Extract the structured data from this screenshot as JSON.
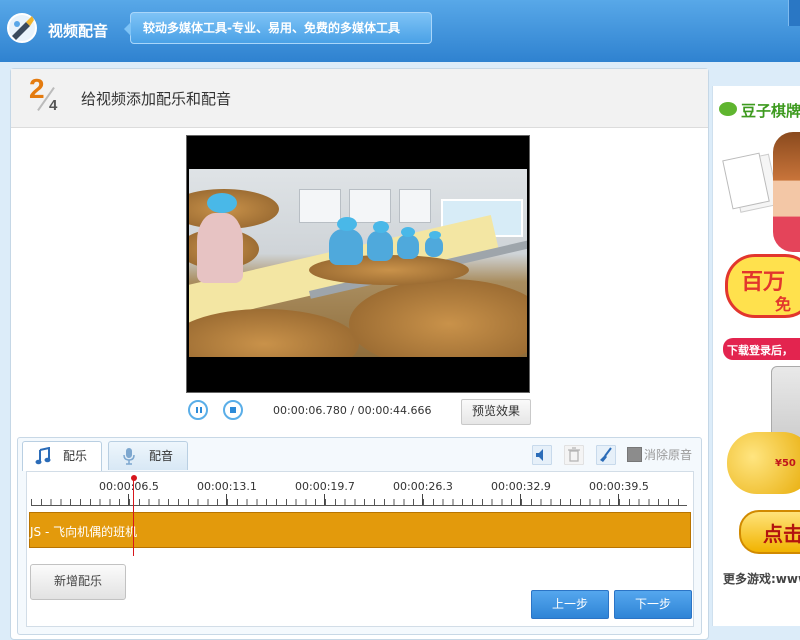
{
  "app": {
    "title": "视频配音",
    "slogan": "较动多媒体工具-专业、易用、免费的多媒体工具"
  },
  "step": {
    "current": "2",
    "total": "4",
    "title": "给视频添加配乐和配音"
  },
  "player": {
    "current_time": "00:00:06.780",
    "separator": "/",
    "total_time": "00:00:44.666",
    "preview_label": "预览效果",
    "pause_icon": "pause-icon",
    "stop_icon": "stop-icon"
  },
  "tabs": [
    {
      "label": "配乐",
      "icon": "music-note-icon",
      "active": true
    },
    {
      "label": "配音",
      "icon": "microphone-icon",
      "active": false
    }
  ],
  "tools": {
    "volume_icon": "speaker-icon",
    "delete_icon": "trash-icon",
    "clear_icon": "broom-icon",
    "mute_original_label": "消除原音",
    "mute_original_checked": false
  },
  "timeline": {
    "ticks": [
      "00:00:06.5",
      "00:00:13.1",
      "00:00:19.7",
      "00:00:26.3",
      "00:00:32.9",
      "00:00:39.5"
    ],
    "clip_label": "JS - 飞向机偶的班机",
    "clip_color": "#e39a0c",
    "playhead_color": "#d7161c"
  },
  "buttons": {
    "add_music": "新增配乐",
    "prev": "上一步",
    "next": "下一步"
  },
  "ad": {
    "brand": "豆子棋牌",
    "headline": "百万",
    "headline_sub": "免",
    "banner": "下载登录后，",
    "coins_text": "¥50",
    "cta": "点击",
    "more": "更多游戏:www"
  },
  "colors": {
    "accent": "#2f84d6",
    "step_number": "#e47b0f"
  }
}
